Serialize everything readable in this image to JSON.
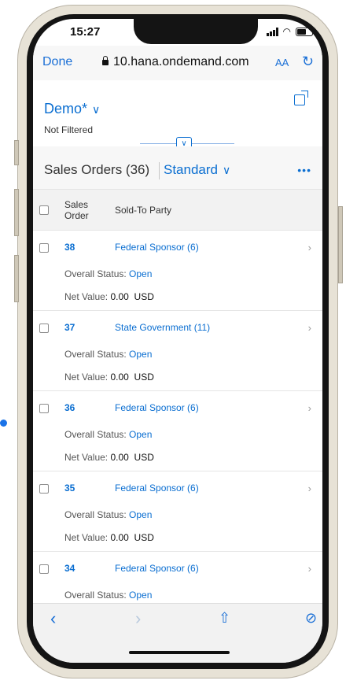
{
  "status": {
    "time": "15:27"
  },
  "browser": {
    "done": "Done",
    "url": "10.hana.ondemand.com",
    "text_size": "AA"
  },
  "filter": {
    "variant": "Demo*",
    "status": "Not Filtered"
  },
  "list": {
    "title": "Sales Orders (36)",
    "view": "Standard",
    "more": "•••"
  },
  "columns": {
    "sales_order": "Sales Order",
    "sold_to": "Sold-To Party"
  },
  "labels": {
    "overall_status": "Overall Status:",
    "net_value": "Net Value:"
  },
  "rows": [
    {
      "order": "38",
      "party": "Federal Sponsor (6)",
      "status": "Open",
      "net_value": "0.00",
      "currency": "USD"
    },
    {
      "order": "37",
      "party": "State Government (11)",
      "status": "Open",
      "net_value": "0.00",
      "currency": "USD"
    },
    {
      "order": "36",
      "party": "Federal Sponsor (6)",
      "status": "Open",
      "net_value": "0.00",
      "currency": "USD"
    },
    {
      "order": "35",
      "party": "Federal Sponsor (6)",
      "status": "Open",
      "net_value": "0.00",
      "currency": "USD"
    },
    {
      "order": "34",
      "party": "Federal Sponsor (6)",
      "status": "Open"
    }
  ],
  "colors": {
    "accent": "#0a6ed1",
    "safari_blue": "#1a6fd6",
    "frame": "#e7e2d6"
  },
  "icons": [
    "lock-icon",
    "reload-icon",
    "share-icon",
    "collapse-icon",
    "back-icon",
    "forward-icon",
    "share-sheet-icon",
    "compass-icon"
  ]
}
